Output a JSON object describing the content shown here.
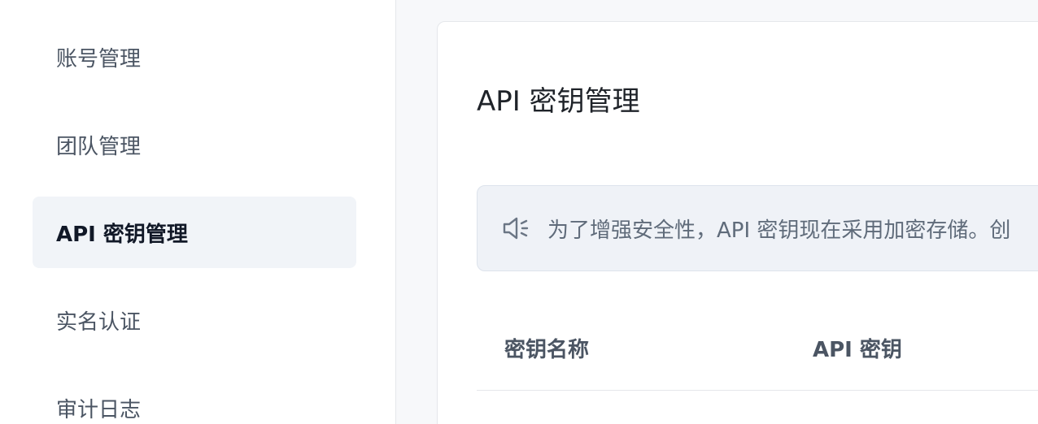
{
  "sidebar": {
    "items": [
      {
        "label": "账号管理",
        "active": false
      },
      {
        "label": "团队管理",
        "active": false
      },
      {
        "label": "API 密钥管理",
        "active": true
      },
      {
        "label": "实名认证",
        "active": false
      },
      {
        "label": "审计日志",
        "active": false
      }
    ]
  },
  "main": {
    "title": "API 密钥管理",
    "notice": {
      "icon": "speaker-icon",
      "text": "为了增强安全性，API 密钥现在采用加密存储。创"
    },
    "table": {
      "columns": [
        "密钥名称",
        "API 密钥"
      ]
    }
  },
  "colors": {
    "active_bg": "#f1f4f8",
    "notice_bg": "#eff2f7",
    "muted_text": "#5f6b7a"
  }
}
